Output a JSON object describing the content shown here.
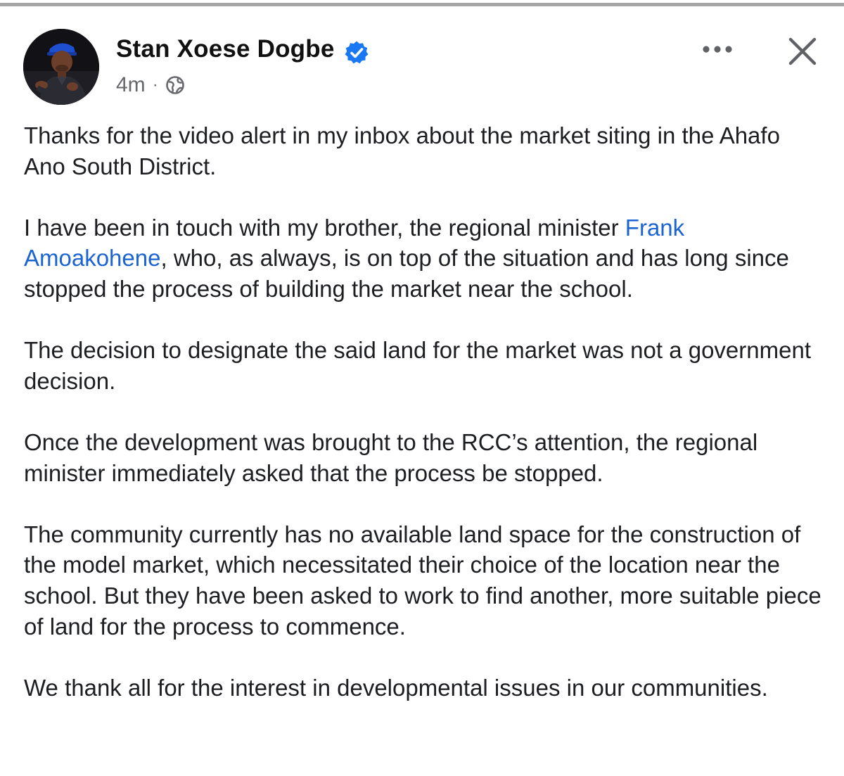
{
  "post": {
    "author": {
      "name": "Stan Xoese Dogbe",
      "verified": true,
      "avatar_icon": "profile-photo"
    },
    "timestamp": "4m",
    "separator": "·",
    "audience_icon": "globe-icon",
    "actions": {
      "more_icon": "ellipsis-icon",
      "close_icon": "close-icon"
    },
    "paragraphs": {
      "p1": "Thanks for the video alert in my inbox about the market siting in the Ahafo Ano South District.",
      "p2_before": "I have been in touch with my brother, the regional minister ",
      "p2_mention": "Frank Amoakohene",
      "p2_after": ", who, as always, is on top of the situation and has long since stopped the process of building the market near the school.",
      "p3": "The decision to designate the said land for the market was not a government decision.",
      "p4": "Once the development was brought to the RCC’s attention, the regional minister immediately asked that the process be stopped.",
      "p5": "The community currently has no available land space for the construction of the model market, which necessitated their choice of the location near the school. But they have been asked to work to find another, more suitable piece of land for the process to commence.",
      "p6": "We thank all for the interest in developmental issues in our communities."
    }
  },
  "colors": {
    "link": "#1b64d1",
    "verified": "#1877f2",
    "meta_text": "#65676b",
    "body_text": "#1c1e21"
  }
}
